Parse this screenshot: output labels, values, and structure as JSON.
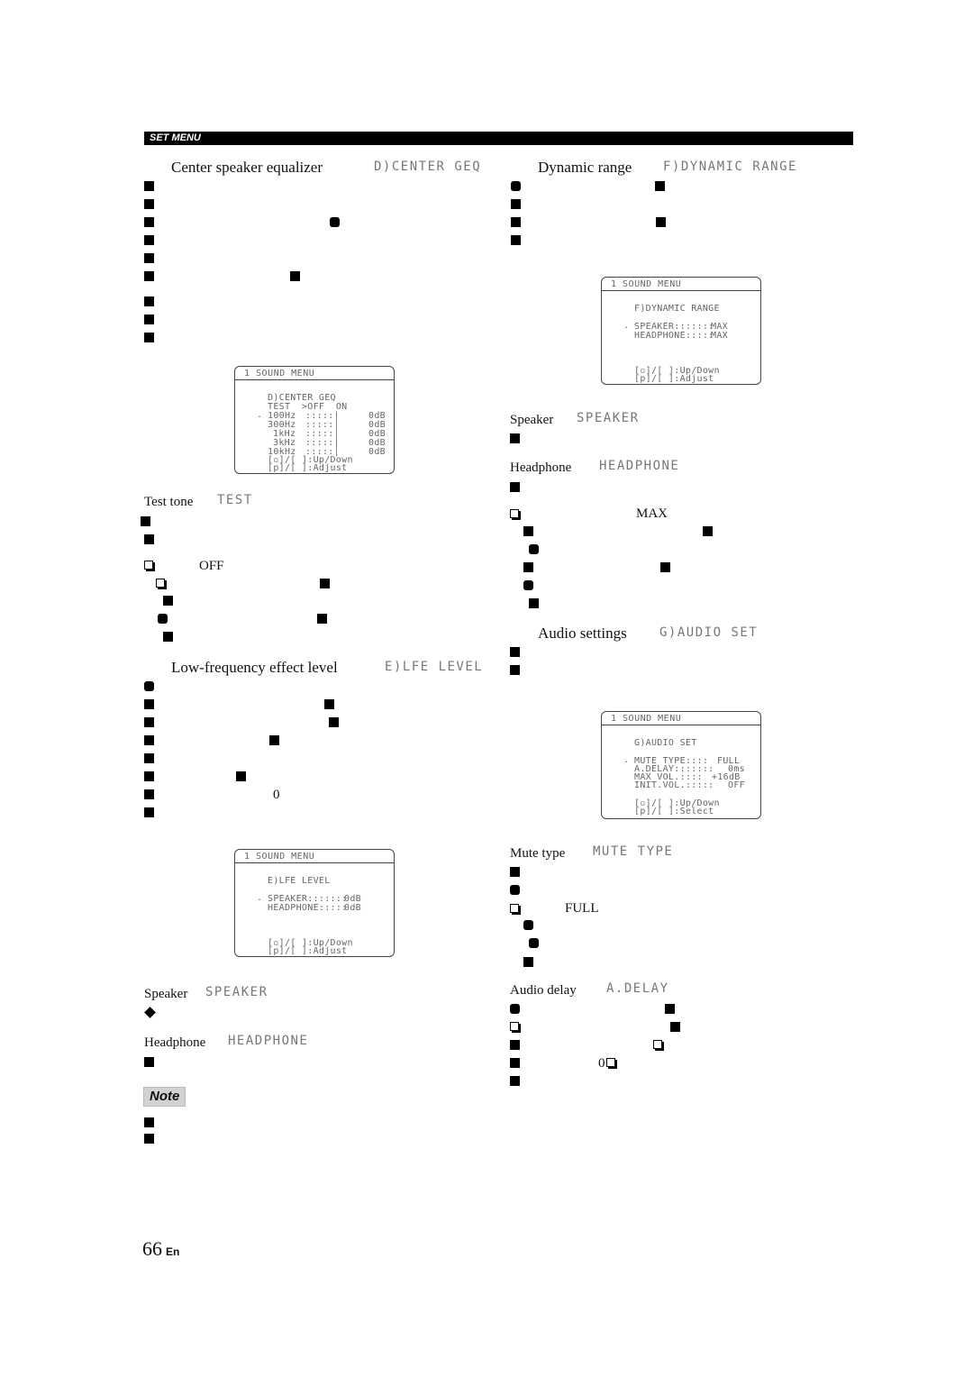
{
  "header": {
    "section_label": "SET MENU"
  },
  "left": {
    "center_geq": {
      "title": "Center speaker equalizer",
      "code": "D)CENTER GEQ"
    },
    "screen_geq": {
      "top": "1 SOUND MENU",
      "heading": "D)CENTER GEQ",
      "test_row": "TEST  >OFF  ON",
      "bands": [
        {
          "freq": "100Hz",
          "value": "0dB"
        },
        {
          "freq": "300Hz",
          "value": "0dB"
        },
        {
          "freq": "1kHz",
          "value": "0dB"
        },
        {
          "freq": "3kHz",
          "value": "0dB"
        },
        {
          "freq": "10kHz",
          "value": "0dB"
        }
      ],
      "hint1": "]/[ ]:Up/Down",
      "hint2": "[p]/[ ]:Adjust"
    },
    "test_tone": {
      "title": "Test tone",
      "code": "TEST",
      "default_value": "OFF"
    },
    "lfe": {
      "title": "Low-frequency effect level",
      "code": "E)LFE LEVEL",
      "inline_value": "0"
    },
    "screen_lfe": {
      "top": "1 SOUND MENU",
      "heading": "E)LFE LEVEL",
      "rows": [
        {
          "label": "SPEAKER:::::::",
          "value": "0dB"
        },
        {
          "label": "HEADPHONE:::::",
          "value": "0dB"
        }
      ],
      "hint1": "]/[ ]:Up/Down",
      "hint2": "[p]/[ ]:Adjust"
    },
    "speaker": {
      "title": "Speaker",
      "code": "SPEAKER"
    },
    "headphone": {
      "title": "Headphone",
      "code": "HEADPHONE"
    },
    "note": {
      "label": "Note"
    }
  },
  "right": {
    "dynamic_range": {
      "title": "Dynamic range",
      "code": "F)DYNAMIC RANGE"
    },
    "screen_dr": {
      "top": "1 SOUND MENU",
      "heading": "F)DYNAMIC RANGE",
      "rows": [
        {
          "label": "SPEAKER:::::::",
          "value": "MAX"
        },
        {
          "label": "HEADPHONE:::::",
          "value": "MAX"
        }
      ],
      "hint1": "]/[ ]:Up/Down",
      "hint2": "[p]/[ ]:Adjust"
    },
    "speaker": {
      "title": "Speaker",
      "code": "SPEAKER"
    },
    "headphone": {
      "title": "Headphone",
      "code": "HEADPHONE",
      "default_value": "MAX"
    },
    "audio_set": {
      "title": "Audio settings",
      "code": "G)AUDIO SET"
    },
    "screen_audio": {
      "top": "1 SOUND MENU",
      "heading": "G)AUDIO SET",
      "rows": [
        {
          "label": "MUTE TYPE::::",
          "value": "FULL"
        },
        {
          "label": "A.DELAY:::::::",
          "value": "0ms"
        },
        {
          "label": "MAX VOL.::::",
          "value": "+16dB"
        },
        {
          "label": "INIT.VOL.:::::",
          "value": "OFF"
        }
      ],
      "hint1": "]/[ ]:Up/Down",
      "hint2": "[p]/[ ]:Select"
    },
    "mute_type": {
      "title": "Mute type",
      "code": "MUTE TYPE",
      "default_value": "FULL"
    },
    "audio_delay": {
      "title": "Audio delay",
      "code": "A.DELAY",
      "inline_value": "0"
    }
  },
  "footer": {
    "page_number": "66",
    "language": "En"
  }
}
